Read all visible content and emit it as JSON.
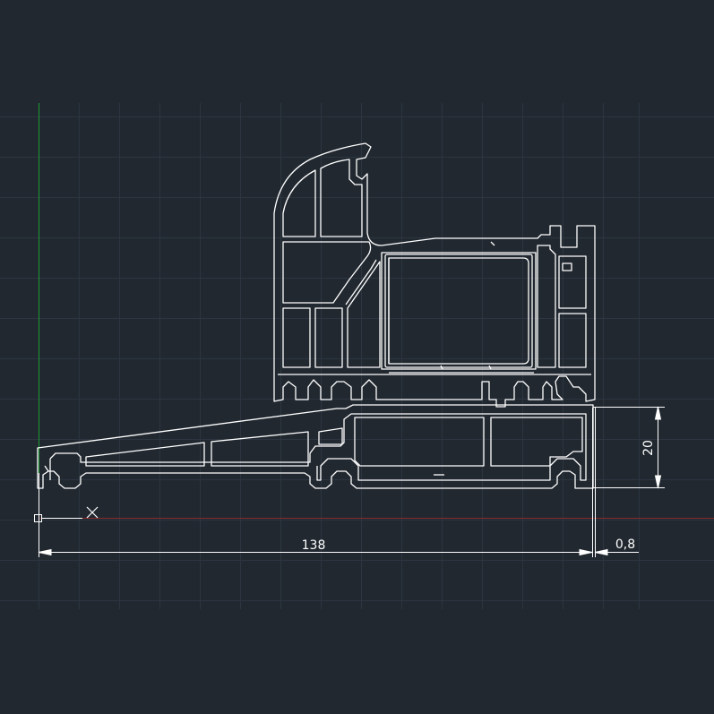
{
  "viewport": {
    "background": "#212830",
    "grid_color": "#2c3540",
    "ucs_y_axis_color": "#1f9a35",
    "ucs_x_axis_color": "#8a2b2b",
    "line_color": "#ffffff"
  },
  "dimensions": {
    "width_total": "138",
    "gap": "0,8",
    "height": "20"
  },
  "icons": {
    "ucs": "ucs-origin-icon",
    "cursor": "crosshair-x-icon"
  }
}
